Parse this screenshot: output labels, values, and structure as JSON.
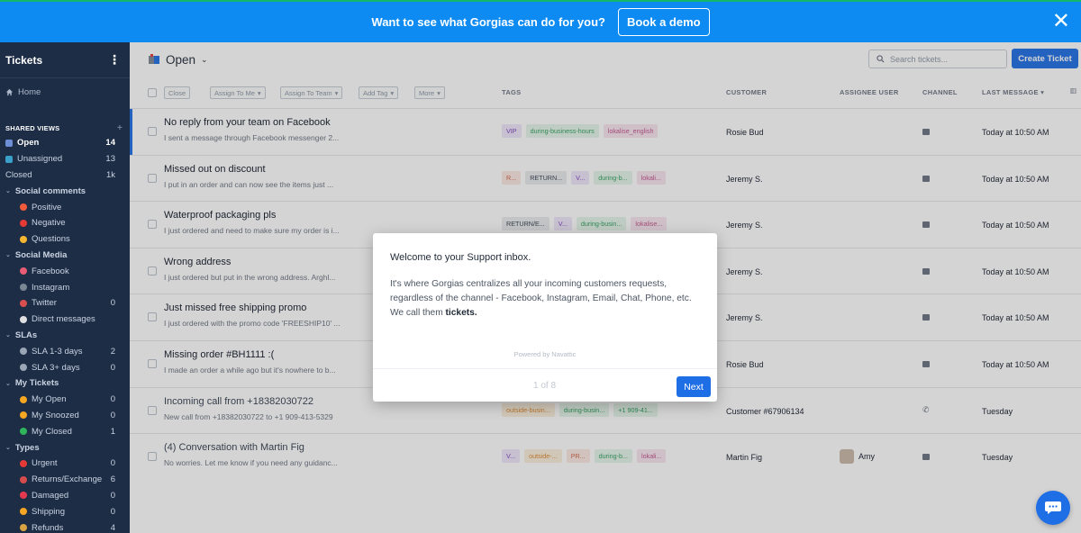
{
  "banner": {
    "message": "Want to see what Gorgias can do for you?",
    "cta": "Book a demo",
    "close": "✕"
  },
  "sidebar": {
    "title": "Tickets",
    "menu_icon": "⋮",
    "home": "Home",
    "shared_views_label": "SHARED VIEWS",
    "shared_views_add": "+",
    "views": [
      {
        "label": "Open",
        "count": "14",
        "active": true
      },
      {
        "label": "Unassigned",
        "count": "13"
      },
      {
        "label": "Closed",
        "count": "1k"
      }
    ],
    "groups": [
      {
        "label": "Social comments",
        "items": [
          {
            "label": "Positive",
            "count": "",
            "color": "#f25a3c"
          },
          {
            "label": "Negative",
            "count": "",
            "color": "#e53935"
          },
          {
            "label": "Questions",
            "count": "",
            "color": "#f5b731"
          }
        ]
      },
      {
        "label": "Social Media",
        "items": [
          {
            "label": "Facebook",
            "count": "",
            "color": "#e85d75"
          },
          {
            "label": "Instagram",
            "count": "",
            "color": "#7b8794"
          },
          {
            "label": "Twitter",
            "count": "0",
            "color": "#d94f4f"
          },
          {
            "label": "Direct messages",
            "count": "",
            "color": "#e0e0e0"
          }
        ]
      },
      {
        "label": "SLAs",
        "items": [
          {
            "label": "SLA 1-3 days",
            "count": "2",
            "color": "#9aa5b5"
          },
          {
            "label": "SLA 3+ days",
            "count": "0",
            "color": "#9aa5b5"
          }
        ]
      },
      {
        "label": "My Tickets",
        "items": [
          {
            "label": "My Open",
            "count": "0",
            "color": "#f5a623"
          },
          {
            "label": "My Snoozed",
            "count": "0",
            "color": "#f5a623"
          },
          {
            "label": "My Closed",
            "count": "1",
            "color": "#2fb35b"
          }
        ]
      },
      {
        "label": "Types",
        "items": [
          {
            "label": "Urgent",
            "count": "0",
            "color": "#e53935"
          },
          {
            "label": "Returns/Exchange",
            "count": "6",
            "color": "#d64b4b"
          },
          {
            "label": "Damaged",
            "count": "0",
            "color": "#e53950"
          },
          {
            "label": "Shipping",
            "count": "0",
            "color": "#f5a623"
          },
          {
            "label": "Refunds",
            "count": "4",
            "color": "#d9a441"
          }
        ]
      }
    ]
  },
  "header": {
    "view_name": "Open",
    "search_placeholder": "Search tickets...",
    "create_label": "Create Ticket"
  },
  "toolbar": {
    "close": "Close",
    "assign_me": "Assign To Me",
    "assign_team": "Assign To Team",
    "add_tag": "Add Tag",
    "more": "More"
  },
  "columns": {
    "tags": "TAGS",
    "customer": "CUSTOMER",
    "assignee": "ASSIGNEE USER",
    "channel": "CHANNEL",
    "last_message": "LAST MESSAGE"
  },
  "tickets": [
    {
      "subject": "No reply from your team on Facebook",
      "preview": "I sent a message through Facebook messenger 2...",
      "customer": "Rosie Bud",
      "assignee": "",
      "time": "Today at 10:50 AM",
      "bold": true,
      "tags": [
        {
          "t": "VIP",
          "c": "#7b3fbf",
          "b": "#efe6fa"
        },
        {
          "t": "during-business-hours",
          "c": "#2e9e5b",
          "b": "#e4f5ea"
        },
        {
          "t": "lokalise_english",
          "c": "#c0508b",
          "b": "#f9e6f0"
        }
      ]
    },
    {
      "subject": "Missed out on discount",
      "preview": "I put in an order and can now see the items just ...",
      "customer": "Jeremy S.",
      "assignee": "",
      "time": "Today at 10:50 AM",
      "bold": true,
      "tags": [
        {
          "t": "R...",
          "c": "#d0664a",
          "b": "#fbe8e2"
        },
        {
          "t": "RETURN...",
          "c": "#374151",
          "b": "#e9ebee"
        },
        {
          "t": "V...",
          "c": "#7b3fbf",
          "b": "#efe6fa"
        },
        {
          "t": "during-b...",
          "c": "#2e9e5b",
          "b": "#e4f5ea"
        },
        {
          "t": "lokali...",
          "c": "#c0508b",
          "b": "#f9e6f0"
        }
      ]
    },
    {
      "subject": "Waterproof packaging pls",
      "preview": "I just ordered and need to make sure my order is i...",
      "customer": "Jeremy S.",
      "assignee": "",
      "time": "Today at 10:50 AM",
      "bold": true,
      "tags": [
        {
          "t": "RETURN/E...",
          "c": "#374151",
          "b": "#e9ebee"
        },
        {
          "t": "V...",
          "c": "#7b3fbf",
          "b": "#efe6fa"
        },
        {
          "t": "during-busin...",
          "c": "#2e9e5b",
          "b": "#e4f5ea"
        },
        {
          "t": "lokalise...",
          "c": "#c0508b",
          "b": "#f9e6f0"
        }
      ]
    },
    {
      "subject": "Wrong address",
      "preview": "I just ordered but put in the wrong address. Arghl...",
      "customer": "Jeremy S.",
      "assignee": "",
      "time": "Today at 10:50 AM",
      "bold": true,
      "tags": []
    },
    {
      "subject": "Just missed free shipping promo",
      "preview": "I just ordered with the promo code 'FREESHIP10' ...",
      "customer": "Jeremy S.",
      "assignee": "",
      "time": "Today at 10:50 AM",
      "bold": true,
      "tags": []
    },
    {
      "subject": "Missing order #BH1111 :(",
      "preview": "I made an order a while ago but it's nowhere to b...",
      "customer": "Rosie Bud",
      "assignee": "",
      "time": "Today at 10:50 AM",
      "bold": true,
      "tags": []
    },
    {
      "subject": "Incoming call from +18382030722",
      "preview": "New call from +18382030722 to +1 909-413-5329",
      "customer": "Customer #67906134",
      "assignee": "",
      "time": "Tuesday",
      "bold": false,
      "tags": [
        {
          "t": "outside-busin...",
          "c": "#d9882e",
          "b": "#fcefdc"
        },
        {
          "t": "during-busin...",
          "c": "#2e9e5b",
          "b": "#e4f5ea"
        },
        {
          "t": "+1 909-41...",
          "c": "#2e9e5b",
          "b": "#e4f5ea"
        }
      ]
    },
    {
      "subject": "(4) Conversation with Martin Fig",
      "preview": "No worries. Let me know if you need any guidanc...",
      "customer": "Martin Fig",
      "assignee": "Amy",
      "time": "Tuesday",
      "bold": false,
      "tags": [
        {
          "t": "V...",
          "c": "#7b3fbf",
          "b": "#efe6fa"
        },
        {
          "t": "outside-...",
          "c": "#d9882e",
          "b": "#fcefdc"
        },
        {
          "t": "PR...",
          "c": "#d0664a",
          "b": "#fbe8e2"
        },
        {
          "t": "during-b...",
          "c": "#2e9e5b",
          "b": "#e4f5ea"
        },
        {
          "t": "lokali...",
          "c": "#c0508b",
          "b": "#f9e6f0"
        }
      ]
    }
  ],
  "modal": {
    "title": "Welcome to your Support inbox.",
    "body": "It's where Gorgias centralizes all your incoming customers requests, regardless of the channel - Facebook, Instagram, Email, Chat, Phone, etc. We call them ",
    "body_bold": "tickets.",
    "powered": "Powered by Navattic",
    "page": "1 of 8",
    "next": "Next"
  },
  "colors": {
    "accent": "#1e6ee6",
    "banner": "#0d8bf2",
    "sidebar": "#1e2d46"
  }
}
